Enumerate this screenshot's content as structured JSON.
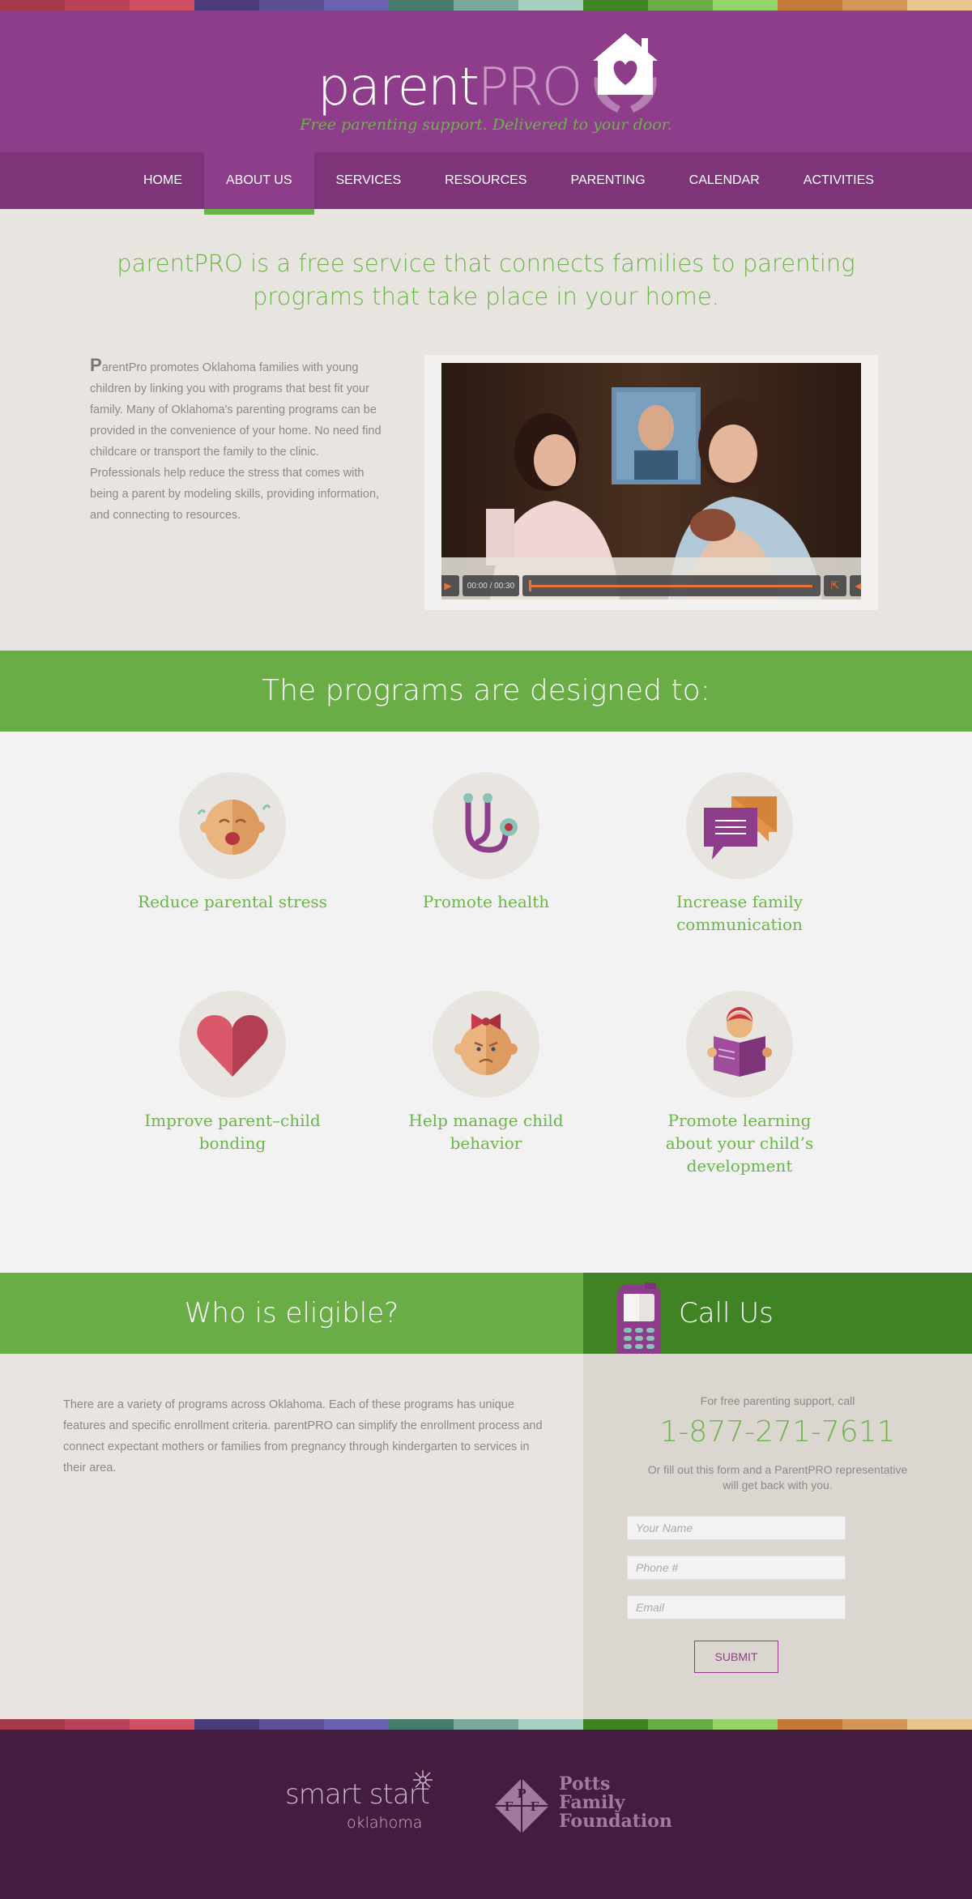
{
  "colors": {
    "purple": "#8e3d8b",
    "nav_purple": "#7d3479",
    "green": "#6aad47",
    "dark_green": "#3f8324",
    "footer": "#441c40",
    "strip": [
      "#a3394a",
      "#b8425a",
      "#cf4f64",
      "#4a3b7a",
      "#5a4f93",
      "#6b62ad",
      "#467a6b",
      "#7aa89a",
      "#a6cfc2",
      "#3f8324",
      "#6aad47",
      "#95d46a",
      "#c3783c",
      "#d39658",
      "#e8c78e"
    ]
  },
  "header": {
    "logo_parent": "parent",
    "logo_pro": "PRO",
    "tagline": "Free parenting support. Delivered to your door."
  },
  "nav": {
    "items": [
      "HOME",
      "ABOUT US",
      "SERVICES",
      "RESOURCES",
      "PARENTING",
      "CALENDAR",
      "ACTIVITIES"
    ],
    "active": "ABOUT US"
  },
  "intro": {
    "title": "parentPRO is a free service that connects families to parenting programs that take place in your home.",
    "dropcap": "P",
    "body": "arentPro promotes Oklahoma families with young children by linking you with programs that best fit your family. Many of Oklahoma's parenting programs can be provided in the convenience of your home. No need find childcare or transport the family to the clinic. Professionals help reduce the stress that comes with being a parent by modeling skills, providing information, and connecting to resources."
  },
  "video": {
    "time": "00:00 / 00:30",
    "play_icon": "play-icon",
    "fullscreen_icon": "fullscreen-icon",
    "volume_icon": "volume-icon"
  },
  "programs": {
    "heading": "The programs are designed to:",
    "items": [
      {
        "label": "Reduce parental stress",
        "icon": "crying-baby-icon"
      },
      {
        "label": "Promote health",
        "icon": "stethoscope-icon"
      },
      {
        "label": "Increase family communication",
        "icon": "speech-bubbles-icon"
      },
      {
        "label": "Improve parent–child bonding",
        "icon": "heart-icon"
      },
      {
        "label": "Help manage child behavior",
        "icon": "upset-baby-girl-icon"
      },
      {
        "label": "Promote learning about your child’s development",
        "icon": "child-reading-icon"
      }
    ]
  },
  "eligibility": {
    "heading": "Who is eligible?",
    "body": "There are a variety of programs across Oklahoma. Each of these programs has unique features and specific enrollment criteria. parentPRO can simplify the enrollment process and connect expectant mothers or families from pregnancy through kindergarten to services in their area."
  },
  "call": {
    "heading": "Call Us",
    "intro": "For free parenting support, call",
    "number": "1-877-271-7611",
    "note": "Or fill out this form and a ParentPRO representative will get back with you.",
    "name_placeholder": "Your Name",
    "phone_placeholder": "Phone #",
    "email_placeholder": "Email",
    "submit": "SUBMIT"
  },
  "footer": {
    "smart_start_1": "smart start",
    "smart_start_2": "oklahoma",
    "pff_line1": "Potts",
    "pff_line2": "Family",
    "pff_line3": "Foundation",
    "pff_letters": [
      "P",
      "F",
      "F"
    ]
  }
}
